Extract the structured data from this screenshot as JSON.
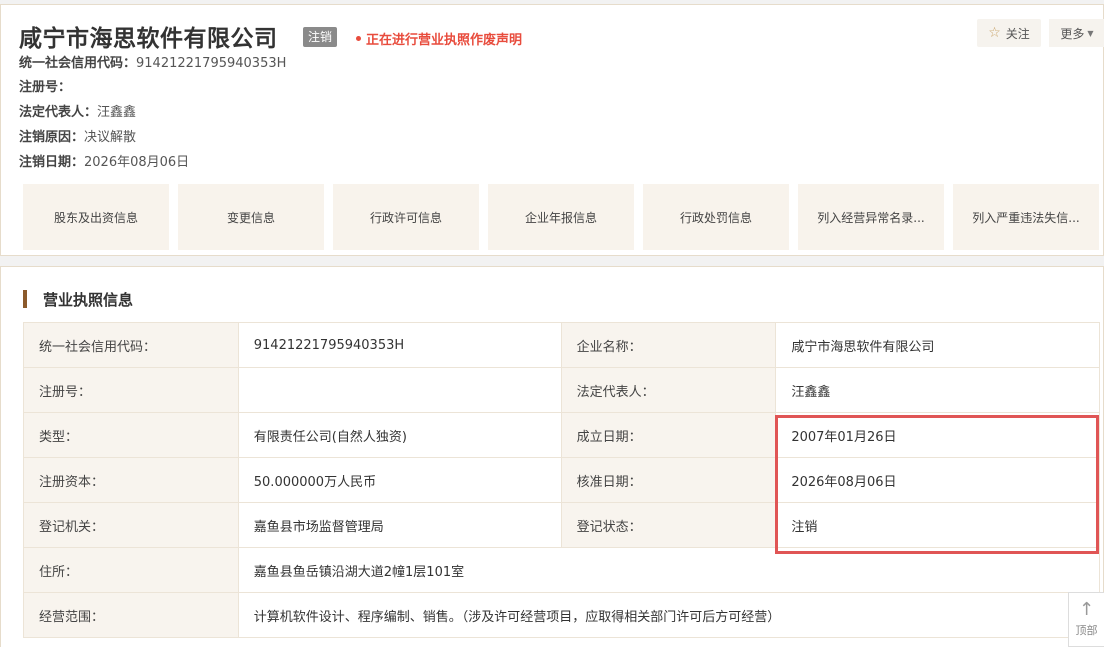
{
  "header": {
    "company_name": "咸宁市海思软件有限公司",
    "status_tag": "注销",
    "notice": "正在进行营业执照作废声明",
    "follow_label": "关注",
    "more_label": "更多",
    "info": [
      {
        "key": "统一社会信用代码：",
        "value": "91421221795940353H"
      },
      {
        "key": "注册号：",
        "value": ""
      },
      {
        "key": "法定代表人：",
        "value": "汪鑫鑫"
      },
      {
        "key": "注销原因：",
        "value": "决议解散"
      },
      {
        "key": "注销日期：",
        "value": "2026年08月06日"
      }
    ]
  },
  "tabs": [
    {
      "label": "股东及出资信息"
    },
    {
      "label": "变更信息"
    },
    {
      "label": "行政许可信息"
    },
    {
      "label": "企业年报信息"
    },
    {
      "label": "行政处罚信息"
    },
    {
      "label": "列入经营异常名录..."
    },
    {
      "label": "列入严重违法失信..."
    }
  ],
  "license": {
    "title": "营业执照信息",
    "rows": [
      {
        "l1": "统一社会信用代码：",
        "v1": "91421221795940353H",
        "l2": "企业名称：",
        "v2": "咸宁市海思软件有限公司"
      },
      {
        "l1": "注册号：",
        "v1": "",
        "l2": "法定代表人：",
        "v2": "汪鑫鑫"
      },
      {
        "l1": "类型：",
        "v1": "有限责任公司(自然人独资)",
        "l2": "成立日期：",
        "v2": "2007年01月26日"
      },
      {
        "l1": "注册资本：",
        "v1": "50.000000万人民币",
        "l2": "核准日期：",
        "v2": "2026年08月06日"
      },
      {
        "l1": "登记机关：",
        "v1": "嘉鱼县市场监督管理局",
        "l2": "登记状态：",
        "v2": "注销"
      }
    ],
    "address_label": "住所：",
    "address_value": "嘉鱼县鱼岳镇沿湖大道2幢1层101室",
    "scope_label": "经营范围：",
    "scope_value": "计算机软件设计、程序编制、销售。（涉及许可经营项目，应取得相关部门许可后方可经营）"
  },
  "back_to_top": "顶部",
  "colors": {
    "accent": "#8b5a2b",
    "alert": "#e84c3d",
    "highlight_box": "#e05555"
  }
}
